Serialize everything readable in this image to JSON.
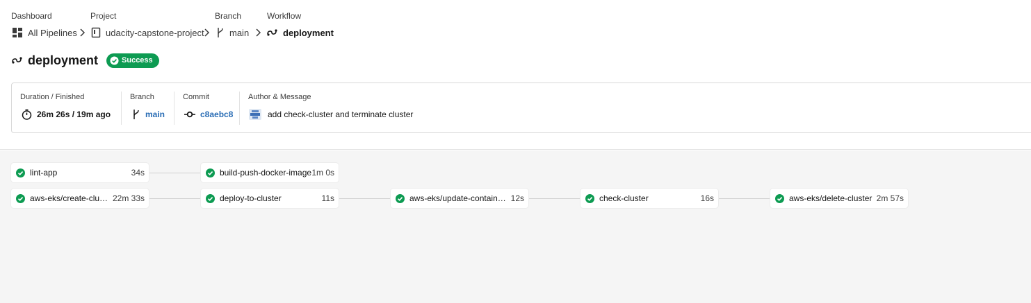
{
  "breadcrumb": {
    "dashboard_label": "Dashboard",
    "dashboard_value": "All Pipelines",
    "project_label": "Project",
    "project_value": "udacity-capstone-project",
    "branch_label": "Branch",
    "branch_value": "main",
    "workflow_label": "Workflow",
    "workflow_value": "deployment"
  },
  "header": {
    "title": "deployment",
    "status": "Success",
    "status_color": "#0d9b52"
  },
  "summary": {
    "duration_label": "Duration / Finished",
    "duration_value": "26m 26s / 19m ago",
    "branch_label": "Branch",
    "branch_value": "main",
    "commit_label": "Commit",
    "commit_value": "c8aebc8",
    "author_label": "Author & Message",
    "message": "add check-cluster and terminate cluster",
    "link_color": "#2a6db5"
  },
  "jobs": [
    {
      "name": "lint-app",
      "duration": "34s",
      "status": "success"
    },
    {
      "name": "build-push-docker-image",
      "duration": "1m 0s",
      "status": "success"
    },
    {
      "name": "aws-eks/create-cluster",
      "duration": "22m 33s",
      "status": "success"
    },
    {
      "name": "deploy-to-cluster",
      "duration": "11s",
      "status": "success"
    },
    {
      "name": "aws-eks/update-container-image",
      "duration": "12s",
      "status": "success"
    },
    {
      "name": "check-cluster",
      "duration": "16s",
      "status": "success"
    },
    {
      "name": "aws-eks/delete-cluster",
      "duration": "2m 57s",
      "status": "success"
    }
  ],
  "icons": {
    "dashboard": "dashboard-icon",
    "project": "project-icon",
    "branch": "branch-icon",
    "workflow": "workflow-icon",
    "timer": "timer-icon",
    "commit": "commit-icon",
    "avatar": "avatar-icon",
    "success": "check-circle-icon"
  }
}
